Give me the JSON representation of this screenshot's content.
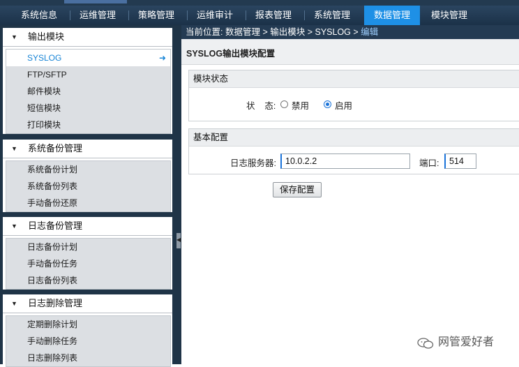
{
  "nav": {
    "items": [
      "系统信息",
      "运维管理",
      "策略管理",
      "运维审计",
      "报表管理",
      "系统管理",
      "数据管理",
      "模块管理"
    ],
    "active_index": 6
  },
  "sidebar": {
    "sections": [
      {
        "title": "输出模块",
        "items": [
          "SYSLOG",
          "FTP/SFTP",
          "邮件模块",
          "短信模块",
          "打印模块"
        ],
        "active_item": 0
      },
      {
        "title": "系统备份管理",
        "items": [
          "系统备份计划",
          "系统备份列表",
          "手动备份还原"
        ]
      },
      {
        "title": "日志备份管理",
        "items": [
          "日志备份计划",
          "手动备份任务",
          "日志备份列表"
        ]
      },
      {
        "title": "日志删除管理",
        "items": [
          "定期删除计划",
          "手动删除任务",
          "日志删除列表"
        ]
      }
    ]
  },
  "breadcrumb": {
    "prefix": "当前位置: ",
    "parts": [
      "数据管理",
      "输出模块",
      "SYSLOG"
    ],
    "separator": " > ",
    "current": "编辑"
  },
  "page": {
    "title": "SYSLOG输出模块配置"
  },
  "module_status": {
    "heading": "模块状态",
    "label": "状    态:",
    "options": [
      "禁用",
      "启用"
    ],
    "selected": "启用"
  },
  "basic_config": {
    "heading": "基本配置",
    "server_label": "日志服务器:",
    "server_value": "10.0.2.2",
    "port_label": "端口:",
    "port_value": "514"
  },
  "actions": {
    "save_label": "保存配置"
  },
  "watermark": {
    "text": "网管爱好者"
  },
  "colors": {
    "accent": "#1e90e6",
    "nav_bg": "#1b3148",
    "sidebar_bg": "#1f3447"
  }
}
